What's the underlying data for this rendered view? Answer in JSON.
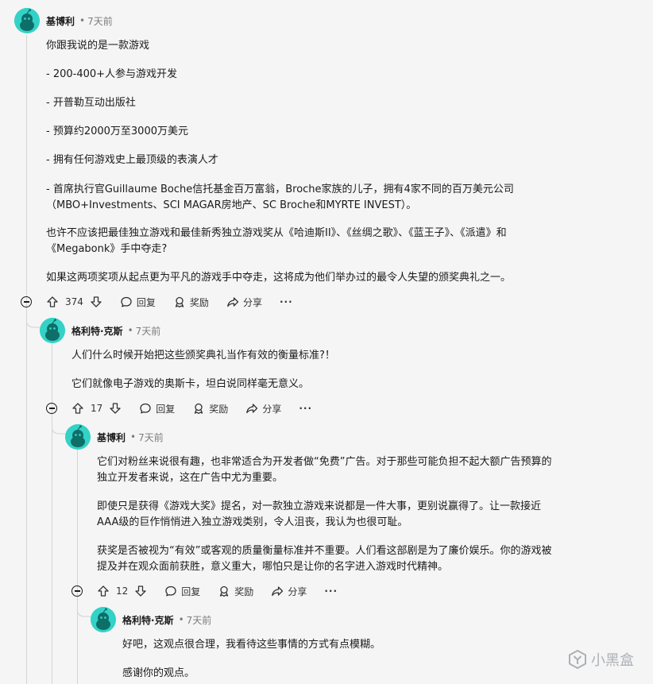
{
  "comments": [
    {
      "username": "基博利",
      "time": "7天前",
      "paragraphs": [
        "你跟我说的是一款游戏",
        "- 200-400+人参与游戏开发",
        "- 开普勒互动出版社",
        "- 预算约2000万至3000万美元",
        "- 拥有任何游戏史上最顶级的表演人才",
        "- 首席执行官Guillaume Boche信托基金百万富翁，Broche家族的儿子，拥有4家不同的百万美元公司",
        "（MBO+Investments、SCI MAGAR房地产、SC Broche和MYRTE INVEST）。",
        "也许不应该把最佳独立游戏和最佳新秀独立游戏奖从《哈迪斯II》、《丝绸之歌》、《蓝王子》、《派遣》和",
        "《Megabonk》手中夺走?",
        "如果这两项奖项从起点更为平凡的游戏手中夺走，这将成为他们举办过的最令人失望的颁奖典礼之一。"
      ],
      "votes": "374"
    },
    {
      "username": "格利特·克斯",
      "time": "7天前",
      "paragraphs": [
        "人们什么时候开始把这些颁奖典礼当作有效的衡量标准?！",
        "它们就像电子游戏的奥斯卡，坦白说同样毫无意义。"
      ],
      "votes": "17"
    },
    {
      "username": "基博利",
      "time": "7天前",
      "paragraphs": [
        "它们对粉丝来说很有趣，也非常适合为开发者做“免费”广告。对于那些可能负担不起大额广告预算的",
        "独立开发者来说，这在广告中尤为重要。",
        "即使只是获得《游戏大奖》提名，对一款独立游戏来说都是一件大事，更别说赢得了。让一款接近",
        "AAA级的巨作悄悄进入独立游戏类别，令人沮丧，我认为也很可耻。",
        "获奖是否被视为“有效”或客观的质量衡量标准并不重要。人们看这部剧是为了廉价娱乐。你的游戏被",
        "提及并在观众面前获胜，意义重大，哪怕只是让你的名字进入游戏时代精神。"
      ],
      "votes": "12"
    },
    {
      "username": "格利特·克斯",
      "time": "7天前",
      "paragraphs": [
        "好吧，这观点很合理，我看待这些事情的方式有点模糊。",
        "感谢你的观点。"
      ]
    }
  ],
  "actions": {
    "reply": "回复",
    "award": "奖励",
    "share": "分享",
    "more": "···",
    "dot": "•"
  },
  "watermark": "小黑盒",
  "colors": {
    "avatar": "#34d2c6",
    "background": "#f5f5f5"
  }
}
